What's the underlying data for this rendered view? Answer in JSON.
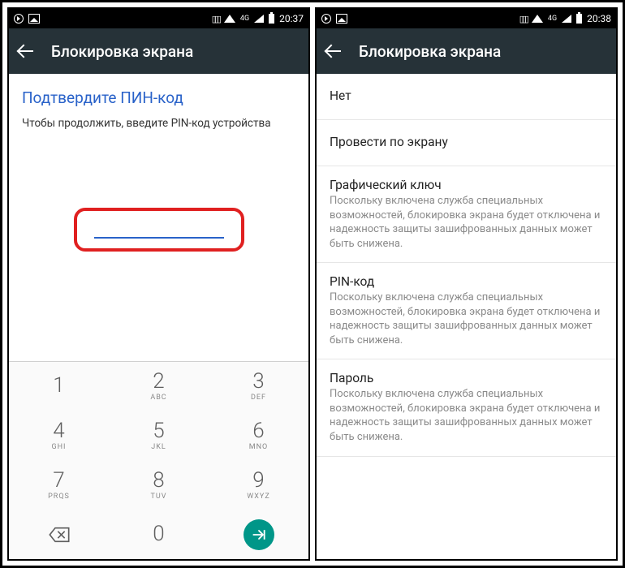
{
  "left": {
    "status": {
      "time": "20:37",
      "net": "4G"
    },
    "appbar": {
      "title": "Блокировка экрана"
    },
    "content": {
      "heading": "Подтвердите ПИН-код",
      "subtext": "Чтобы продолжить, введите PIN-код устройства"
    },
    "keypad": {
      "k1": {
        "d": "1",
        "l": ""
      },
      "k2": {
        "d": "2",
        "l": "ABC"
      },
      "k3": {
        "d": "3",
        "l": "DEF"
      },
      "k4": {
        "d": "4",
        "l": "GHI"
      },
      "k5": {
        "d": "5",
        "l": "JKL"
      },
      "k6": {
        "d": "6",
        "l": "MNO"
      },
      "k7": {
        "d": "7",
        "l": "PRQS"
      },
      "k8": {
        "d": "8",
        "l": "TUV"
      },
      "k9": {
        "d": "9",
        "l": "WXYZ"
      },
      "k0": {
        "d": "0",
        "l": ""
      }
    }
  },
  "right": {
    "status": {
      "time": "20:38",
      "net": "4G"
    },
    "appbar": {
      "title": "Блокировка экрана"
    },
    "options": {
      "none": {
        "title": "Нет"
      },
      "swipe": {
        "title": "Провести по экрану"
      },
      "pattern": {
        "title": "Графический ключ",
        "sub": "Поскольку включена служба специальных возможностей, блокировка экрана будет отключена и надежность защиты зашифрованных данных может быть снижена."
      },
      "pin": {
        "title": "PIN-код",
        "sub": "Поскольку включена служба специальных возможностей, блокировка экрана будет отключена и надежность защиты зашифрованных данных может быть снижена."
      },
      "pass": {
        "title": "Пароль",
        "sub": "Поскольку включена служба специальных возможностей, блокировка экрана будет отключена и надежность защиты зашифрованных данных может быть снижена."
      }
    }
  }
}
